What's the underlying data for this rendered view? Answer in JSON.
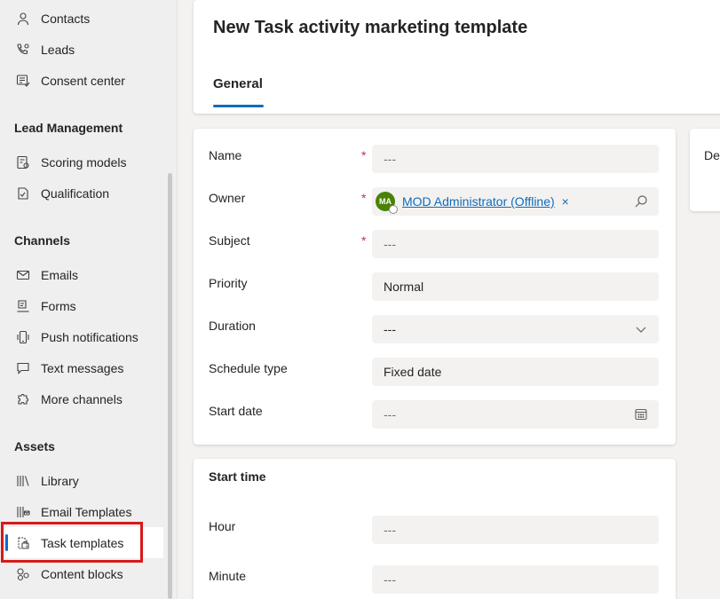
{
  "sidebar": {
    "items_top": [
      {
        "label": "Contacts",
        "icon": "person-icon"
      },
      {
        "label": "Leads",
        "icon": "phone-person-icon"
      },
      {
        "label": "Consent center",
        "icon": "consent-icon"
      }
    ],
    "lead_management": {
      "header": "Lead Management",
      "items": [
        {
          "label": "Scoring models",
          "icon": "scoring-icon"
        },
        {
          "label": "Qualification",
          "icon": "qualification-icon"
        }
      ]
    },
    "channels": {
      "header": "Channels",
      "items": [
        {
          "label": "Emails",
          "icon": "mail-icon"
        },
        {
          "label": "Forms",
          "icon": "form-icon"
        },
        {
          "label": "Push notifications",
          "icon": "mobile-icon"
        },
        {
          "label": "Text messages",
          "icon": "chat-icon"
        },
        {
          "label": "More channels",
          "icon": "puzzle-icon"
        }
      ]
    },
    "assets": {
      "header": "Assets",
      "items": [
        {
          "label": "Library",
          "icon": "library-icon"
        },
        {
          "label": "Email Templates",
          "icon": "email-template-icon"
        },
        {
          "label": "Task templates",
          "icon": "task-template-icon",
          "selected": true
        },
        {
          "label": "Content blocks",
          "icon": "content-blocks-icon"
        }
      ]
    }
  },
  "header": {
    "title": "New Task activity marketing template",
    "tab": "General"
  },
  "form": {
    "name": {
      "label": "Name",
      "value": "---",
      "required": true
    },
    "owner": {
      "label": "Owner",
      "avatar": "MA",
      "value": "MOD Administrator (Offline)",
      "remove": "×",
      "required": true
    },
    "subject": {
      "label": "Subject",
      "value": "---",
      "required": true
    },
    "priority": {
      "label": "Priority",
      "value": "Normal"
    },
    "duration": {
      "label": "Duration",
      "value": "---"
    },
    "schedule_type": {
      "label": "Schedule type",
      "value": "Fixed date"
    },
    "start_date": {
      "label": "Start date",
      "value": "---"
    }
  },
  "start_time": {
    "header": "Start time",
    "hour": {
      "label": "Hour",
      "value": "---"
    },
    "minute": {
      "label": "Minute",
      "value": "---"
    }
  },
  "side_card": {
    "label": "De"
  },
  "required_marker": "*",
  "colors": {
    "accent": "#0f6cbd",
    "required": "#c4314b",
    "highlight": "#d61a1a",
    "avatar": "#498205"
  }
}
